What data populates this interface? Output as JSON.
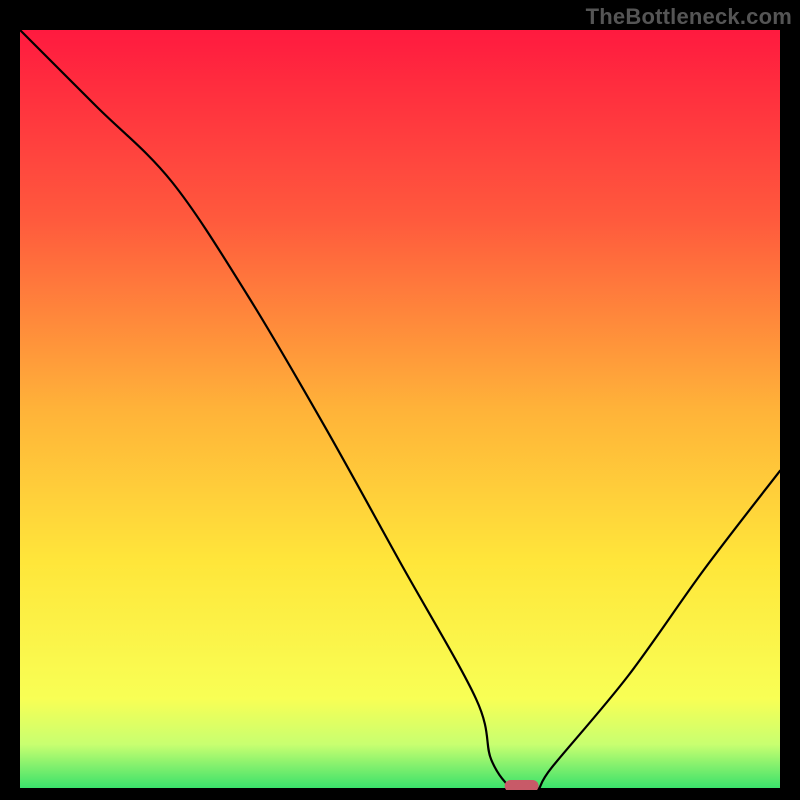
{
  "watermark": "TheBottleneck.com",
  "chart_data": {
    "type": "line",
    "title": "",
    "xlabel": "",
    "ylabel": "",
    "xlim": [
      0,
      100
    ],
    "ylim": [
      0,
      100
    ],
    "series": [
      {
        "name": "bottleneck-curve",
        "x": [
          0,
          10,
          20,
          30,
          40,
          50,
          60,
          62,
          65,
          68,
          70,
          80,
          90,
          100
        ],
        "y": [
          100,
          90,
          80,
          65,
          48,
          30,
          12,
          4,
          0,
          0,
          3,
          15,
          29,
          42
        ]
      }
    ],
    "marker": {
      "x": 66,
      "y": 0,
      "name": "current-point"
    },
    "background_gradient": {
      "stops": [
        {
          "offset": 0.0,
          "color": "#ff1a3f"
        },
        {
          "offset": 0.25,
          "color": "#ff5a3d"
        },
        {
          "offset": 0.5,
          "color": "#ffb339"
        },
        {
          "offset": 0.7,
          "color": "#ffe63a"
        },
        {
          "offset": 0.88,
          "color": "#f8ff55"
        },
        {
          "offset": 0.94,
          "color": "#c8ff70"
        },
        {
          "offset": 1.0,
          "color": "#34e06b"
        }
      ]
    }
  }
}
